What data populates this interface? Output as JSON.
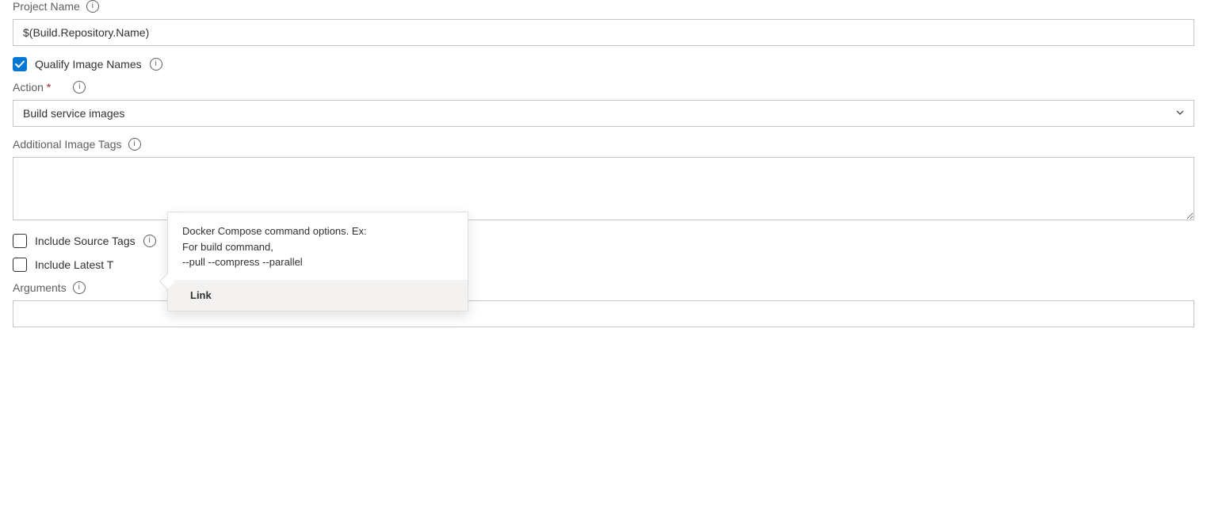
{
  "projectName": {
    "label": "Project Name",
    "value": "$(Build.Repository.Name)"
  },
  "qualifyImageNames": {
    "label": "Qualify Image Names",
    "checked": true
  },
  "action": {
    "label": "Action",
    "value": "Build service images"
  },
  "additionalImageTags": {
    "label": "Additional Image Tags",
    "value": ""
  },
  "includeSourceTags": {
    "label": "Include Source Tags",
    "checked": false
  },
  "includeLatestTag": {
    "label": "Include Latest T",
    "checked": false
  },
  "arguments": {
    "label": "Arguments",
    "value": ""
  },
  "tooltip": {
    "body": "Docker Compose command options. Ex:\nFor build command,\n--pull --compress --parallel",
    "link": "Link"
  }
}
